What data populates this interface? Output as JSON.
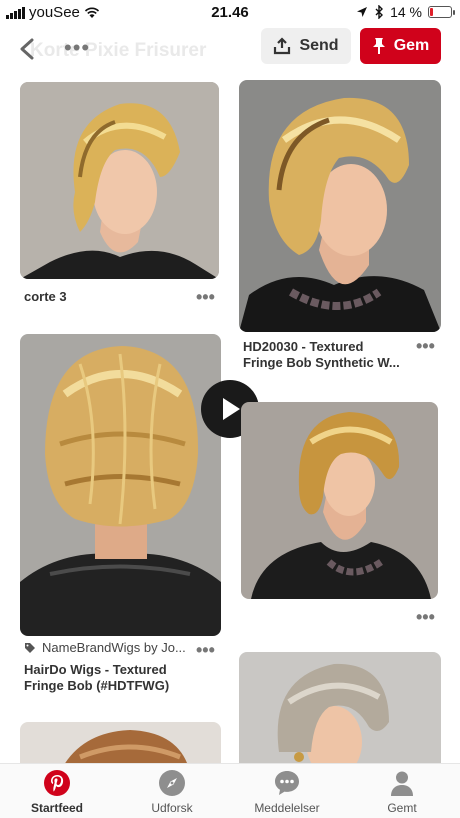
{
  "status": {
    "carrier": "youSee",
    "time": "21.46",
    "battery": "14 %",
    "battery_level": 0.14
  },
  "header": {
    "ghost_title": "Korte Pixie Frisurer",
    "send_label": "Send",
    "gem_label": "Gem"
  },
  "pins": [
    {
      "title": "corte 3"
    },
    {
      "title_line1": "HD20030 - Textured",
      "title_line2": "Fringe Bob Synthetic W..."
    },
    {
      "source": "NameBrandWigs by Jo...",
      "title_line1": "HairDo Wigs - Textured",
      "title_line2": "Fringe Bob (#HDTFWG)"
    }
  ],
  "nav": [
    {
      "label": "Startfeed",
      "icon": "pinterest-icon",
      "active": true
    },
    {
      "label": "Udforsk",
      "icon": "compass-icon",
      "active": false
    },
    {
      "label": "Meddelelser",
      "icon": "chat-icon",
      "active": false
    },
    {
      "label": "Gemt",
      "icon": "person-icon",
      "active": false
    }
  ],
  "colors": {
    "brand_red": "#d0021b",
    "send_bg": "#efefef"
  }
}
